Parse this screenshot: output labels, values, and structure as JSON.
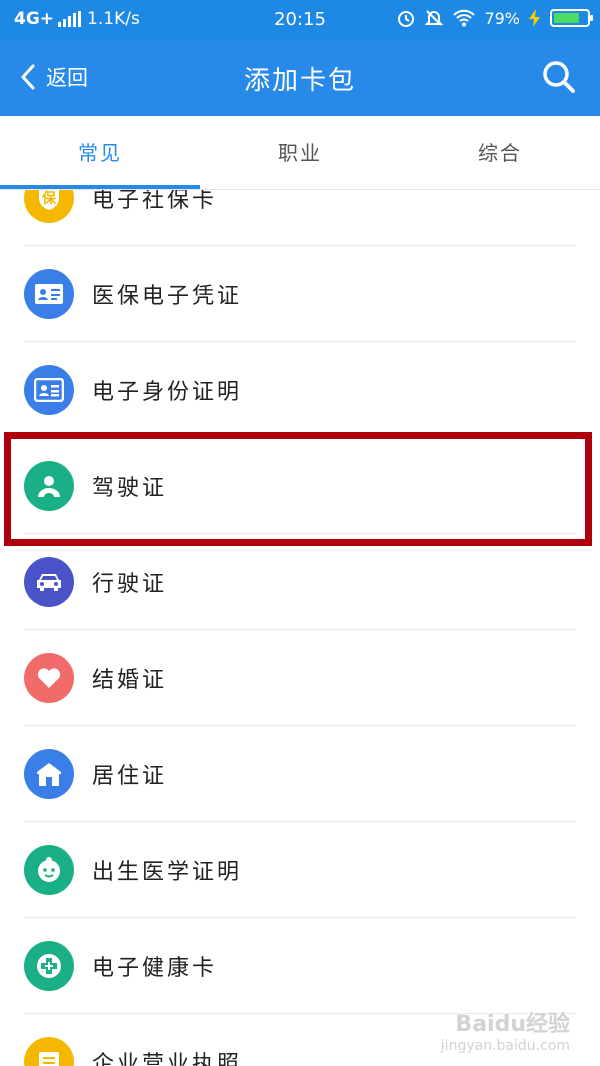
{
  "status_bar": {
    "network": "4G+",
    "speed": "1.1K/s",
    "time": "20:15",
    "battery": "79%",
    "battery_level": 0.79
  },
  "app_bar": {
    "back_label": "返回",
    "title": "添加卡包"
  },
  "tabs": [
    {
      "label": "常见",
      "active": true
    },
    {
      "label": "职业",
      "active": false
    },
    {
      "label": "综合",
      "active": false
    }
  ],
  "items": [
    {
      "label": "电子社保卡",
      "icon": "shield-icon",
      "color": "#f5b800"
    },
    {
      "label": "医保电子凭证",
      "icon": "id-card-icon",
      "color": "#3a7ee8"
    },
    {
      "label": "电子身份证明",
      "icon": "id-card-icon",
      "color": "#3a7ee8"
    },
    {
      "label": "驾驶证",
      "icon": "driver-icon",
      "color": "#1aaf86"
    },
    {
      "label": "行驶证",
      "icon": "car-icon",
      "color": "#4a54c8"
    },
    {
      "label": "结婚证",
      "icon": "heart-icon",
      "color": "#f26b6b"
    },
    {
      "label": "居住证",
      "icon": "house-icon",
      "color": "#3a7ee8"
    },
    {
      "label": "出生医学证明",
      "icon": "baby-icon",
      "color": "#1aaf86"
    },
    {
      "label": "电子健康卡",
      "icon": "medical-cross-icon",
      "color": "#1aaf86"
    },
    {
      "label": "企业营业执照",
      "icon": "license-icon",
      "color": "#f5b800"
    }
  ],
  "shield_glyph": "保",
  "watermark": {
    "line1": "Baidu经验",
    "line2": "jingyan.baidu.com"
  },
  "colors": {
    "primary": "#2789e8",
    "highlight": "#b0000c"
  }
}
